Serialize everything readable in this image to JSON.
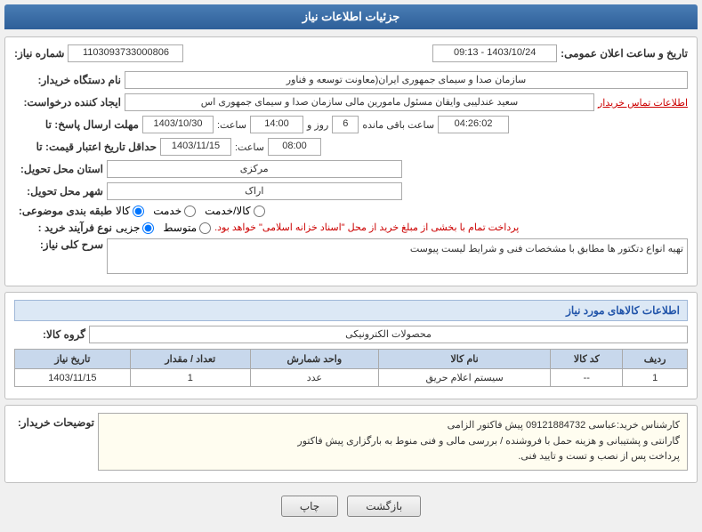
{
  "header": {
    "title": "جزئیات اطلاعات نیاز"
  },
  "fields": {
    "need_number_label": "شماره نیاز:",
    "need_number_value": "1103093733000806",
    "date_label": "تاریخ و ساعت اعلان عمومی:",
    "date_value": "1403/10/24 - 09:13",
    "buyer_org_label": "نام دستگاه خریدار:",
    "buyer_org_value": "سازمان صدا و سیمای جمهوری ایران(معاونت توسعه و فناور",
    "creator_label": "ایجاد کننده درخواست:",
    "creator_value": "سعید عندلیبی وایقان مسئول مامورین مالی  سازمان صدا و سیمای جمهوری اس",
    "creator_link": "اطلاعات تماس خریدار",
    "reply_deadline_label": "مهلت ارسال پاسخ: تا",
    "reply_date": "1403/10/30",
    "reply_time_label": "ساعت:",
    "reply_time": "14:00",
    "reply_day_label": "روز و",
    "reply_day": "6",
    "reply_remaining_label": "ساعت باقی مانده",
    "reply_remaining": "04:26:02",
    "price_deadline_label": "حداقل تاریخ اعتبار قیمت: تا",
    "price_date": "1403/11/15",
    "price_time_label": "ساعت:",
    "price_time": "08:00",
    "province_label": "استان محل تحویل:",
    "province_value": "مرکزی",
    "city_label": "شهر محل تحویل:",
    "city_value": "اراک",
    "category_label": "طبقه بندی موضوعی:",
    "category_options": [
      "کالا",
      "خدمت",
      "کالا/خدمت"
    ],
    "category_selected": "کالا",
    "purchase_type_label": "نوع فرآیند خرید :",
    "purchase_options": [
      "جزیی",
      "متوسط"
    ],
    "purchase_note": "پرداخت تمام با بخشی از مبلغ خرید از محل \"اسناد خزانه اسلامی\" خواهد بود.",
    "description_label": "سرح کلی نیاز:",
    "description_value": "تهیه انواع دتکتور ها مطابق با مشخصات فنی و شرایط لیست پیوست"
  },
  "goods_section": {
    "title": "اطلاعات کالاهای مورد نیاز",
    "group_label": "گروه کالا:",
    "group_value": "محصولات الکترونیکی",
    "table": {
      "columns": [
        "ردیف",
        "کد کالا",
        "نام کالا",
        "واحد شمارش",
        "تعداد / مقدار",
        "تاریخ نیاز"
      ],
      "rows": [
        {
          "row": "1",
          "code": "--",
          "name": "سیستم اعلام حریق",
          "unit": "عدد",
          "quantity": "1",
          "date": "1403/11/15"
        }
      ]
    }
  },
  "buyer_notes": {
    "label": "توضیحات خریدار:",
    "lines": [
      "کارشناس خرید:عباسی 09121884732  پیش فاکتور الزامی",
      "گارانتی و پشتیبانی و هزینه حمل با فروشنده / بررسی مالی و فنی منوط به بارگزاری پیش فاکتور",
      "پرداخت پس از نصب و تست و تایید فنی."
    ]
  },
  "buttons": {
    "print_label": "چاپ",
    "back_label": "بازگشت"
  }
}
